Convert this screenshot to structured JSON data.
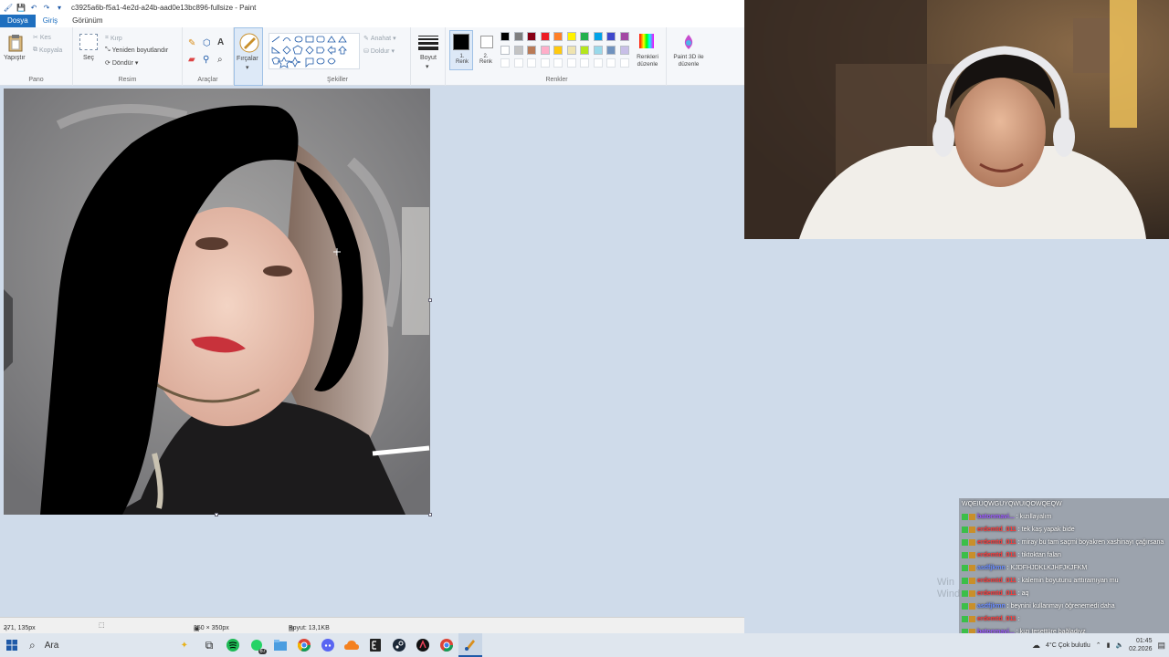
{
  "window": {
    "title": "c3925a6b-f5a1-4e2d-a24b-aad0e13bc896-fullsize - Paint"
  },
  "menu": {
    "tabs": [
      "Dosya",
      "Giriş",
      "Görünüm"
    ]
  },
  "ribbon": {
    "pano": {
      "label": "Pano",
      "paste": "Yapıştır",
      "cut": "Kes",
      "copy": "Kopyala"
    },
    "resim": {
      "label": "Resim",
      "select": "Seç",
      "crop": "Kırp",
      "resize": "Yeniden boyutlandır",
      "rotate": "Döndür"
    },
    "araclar": {
      "label": "Araçlar"
    },
    "brushes": {
      "label": "Fırçalar"
    },
    "sekiller": {
      "label": "Şekiller",
      "outline": "Anahat",
      "fill": "Doldur"
    },
    "size": {
      "label": "Boyut"
    },
    "renkler": {
      "label": "Renkler",
      "color1": "1. Renk",
      "color2": "2. Renk",
      "edit_colors": "Renkleri düzenle",
      "paint3d": "Paint 3D ile düzenle",
      "palette_row1": [
        "#000000",
        "#7f7f7f",
        "#880015",
        "#ed1c24",
        "#ff7f27",
        "#fff200",
        "#22b14c",
        "#00a2e8",
        "#3f48cc",
        "#a349a4"
      ],
      "palette_row2": [
        "#ffffff",
        "#c3c3c3",
        "#b97a57",
        "#ffaec9",
        "#ffc90e",
        "#efe4b0",
        "#b5e61d",
        "#99d9ea",
        "#7092be",
        "#c8bfe7"
      ],
      "color1_value": "#000000",
      "color2_value": "#ffffff"
    }
  },
  "statusbar": {
    "cursor_pos": "271, 135px",
    "image_size": "350 × 350px",
    "file_size": "Boyut: 13,1KB"
  },
  "taskbar": {
    "search_placeholder": "Ara",
    "whatsapp_badge": "67",
    "weather": "4°C Çok bulutlu",
    "time": "01:45",
    "date": "02.2026"
  },
  "watermark": {
    "line1": "Win",
    "line2": "Wind"
  },
  "chat": [
    {
      "user": "",
      "text": "WQEIUQWGUYQWUIQOWQEQW"
    },
    {
      "user": "batonmavi...",
      "text": ": kızıllayalım"
    },
    {
      "user": "erdemtd_011",
      "text": ": tek kaş yapak bide"
    },
    {
      "user": "erdemtd_011",
      "text": ": miray bu tam saçmi boyakren xashinayı çağırsana"
    },
    {
      "user": "erdemtd_011",
      "text": ": tiktoktan falan"
    },
    {
      "user": "asdfjkmn",
      "text": ": KJDFHJDKLKJHFJKJFKM"
    },
    {
      "user": "erdemtd_011",
      "text": ": kalemin boyutunu arttıramıyan mu"
    },
    {
      "user": "erdemtd_011",
      "text": ": aq"
    },
    {
      "user": "asdfjkmn",
      "text": ": beynini kullanmayı öğrenemedi daha"
    },
    {
      "user": "erdemtd_011",
      "text": ": "
    },
    {
      "user": "batonmavi...",
      "text": ": kızı tesettüre bağladıyz"
    }
  ]
}
